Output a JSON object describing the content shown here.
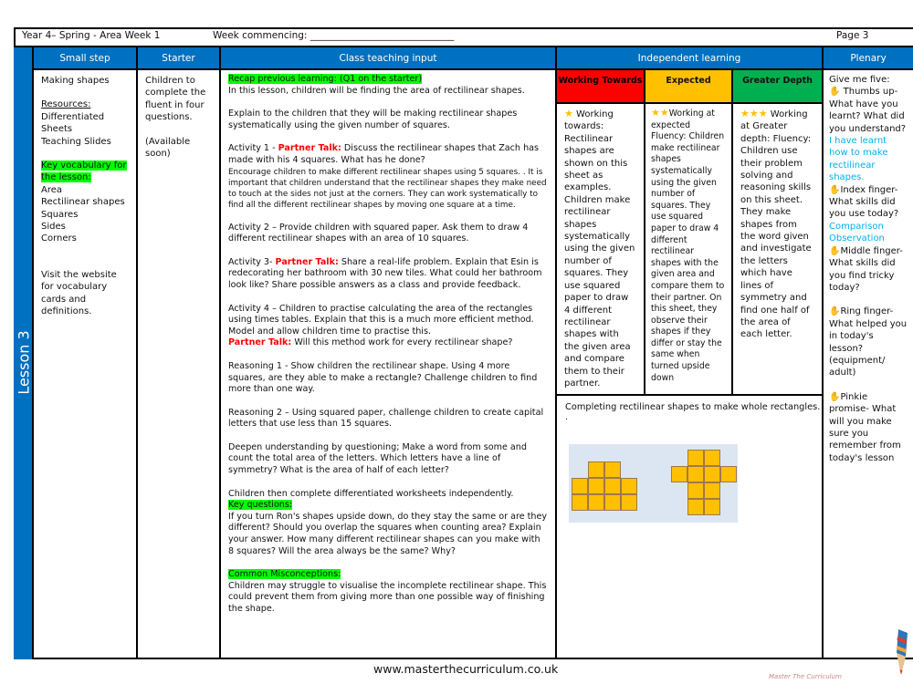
{
  "header": {
    "title": "Year 4– Spring - Area Week 1",
    "week_commencing": "Week commencing: ______________________________",
    "page": "Page 3"
  },
  "columns": {
    "small_step": "Small step",
    "starter": "Starter",
    "class_teaching": "Class teaching input",
    "independent": "Independent learning",
    "plenary": "Plenary"
  },
  "lesson_label": "Lesson 3",
  "small_step": {
    "title": "Making shapes",
    "resources_label": "Resources:",
    "resources": [
      "Differentiated",
      "Sheets",
      "Teaching Slides"
    ],
    "vocab_label_1": "Key vocabulary for",
    "vocab_label_2": "the lesson:",
    "vocab": [
      "Area",
      "Rectilinear shapes",
      "Squares",
      "Sides",
      "Corners"
    ],
    "website_note": "Visit the website for vocabulary cards and definitions."
  },
  "starter": {
    "text": "Children to complete the fluent in four questions.",
    "availability": "(Available soon)"
  },
  "teaching": {
    "recap": "Recap previous learning: (Q1 on the starter)",
    "intro": "In this lesson, children will be finding the area of rectilinear shapes.",
    "explain": "Explain to the children that they will be making rectilinear shapes systematically using the given number of squares.",
    "a1_prefix": "Activity 1 - ",
    "partner_talk": "Partner Talk:",
    "a1_text": " Discuss the rectilinear shapes that Zach has made with his 4 squares. What has he done?",
    "a1_encourage": "Encourage children to make different rectilinear shapes using 5 squares. . It is important that children understand that the rectilinear shapes they make need to touch at the sides not just at the corners. They can work systematically to find all the different rectilinear shapes by moving one square at a time.",
    "a2": "Activity 2 – Provide children with squared paper. Ask them to draw 4 different rectilinear shapes with an area of 10 squares.",
    "a3_prefix": "Activity 3- ",
    "a3_text": " Share a real-life problem. Explain that Esin is redecorating her bathroom with 30 new tiles. What could her bathroom look like? Share possible answers as a class and provide feedback.",
    "a4": "Activity 4 – Children to practise calculating the area of the rectangles using times tables. Explain that this is a much more efficient method. Model and allow children time to practise this.",
    "a4_talk": " Will this method work for every rectilinear shape?",
    "r1": "Reasoning 1  - Show children the rectilinear shape. Using 4 more squares, are they able to make a rectangle? Challenge children to find more than one way.",
    "r2": "Reasoning 2 – Using squared paper, challenge children to create capital letters that use less than 15 squares.",
    "deepen": " Deepen understanding by questioning; Make a word from some and count the total area of the letters. Which letters have a line of symmetry? What is the area of half of each letter?",
    "worksheets": "Children then complete differentiated worksheets independently.",
    "key_q_label": "Key questions:",
    "key_q": "If you turn Ron's shapes upside down, do they stay the same or are they different? Should you overlap the squares when counting area? Explain your answer. How many different rectilinear shapes can you make with 8 squares? Will the area always be the same? Why?",
    "misc_label": "Common Misconceptions:",
    "misc": "Children may struggle to visualise the incomplete rectilinear shape. This could prevent them from giving more than one possible way of finishing the shape."
  },
  "independent": {
    "levels": [
      {
        "label": "Working Towards",
        "color": "#FF0000",
        "stars": "★",
        "text": " Working towards: Rectilinear shapes are shown on this sheet as examples. Children make rectilinear shapes systematically using the given number of squares. They use squared paper to draw 4 different rectilinear shapes with the given area and compare them to their partner."
      },
      {
        "label": "Expected",
        "color": "#FFC000",
        "stars": "★★",
        "text": "Working at expected Fluency: Children make rectilinear shapes systematically using the given number of squares. They use squared paper to draw 4 different rectilinear shapes with the given area and compare them to their partner. On this sheet, they observe their shapes if they differ or stay the same when turned upside down"
      },
      {
        "label": "Greater Depth",
        "color": "#00B050",
        "stars": "★★★",
        "text": " Working at Greater depth: Fluency: Children use their problem solving and reasoning skills on this sheet. They make shapes from the word given and investigate the letters which have lines of symmetry and find one half of the area of each letter."
      }
    ],
    "shapes_caption": "Completing rectilinear shapes to make whole rectangles. ."
  },
  "plenary": {
    "intro": "Give me five:",
    "thumbs": " Thumbs up- What have you learnt? What did you understand?",
    "thumbs_answer": "I have learnt how to make rectilinear shapes.",
    "index": "Index finger- What skills did you use today?",
    "index_answer": "Comparison Observation",
    "middle": "Middle finger- What skills did you find tricky today?",
    "ring": "Ring finger- What helped you in today's lesson? (equipment/ adult)",
    "pinkie": "Pinkie promise- What will you make sure you remember from today's lesson"
  },
  "footer": {
    "url": "www.masterthecurriculum.co.uk",
    "brand": "Master The Curriculum"
  }
}
